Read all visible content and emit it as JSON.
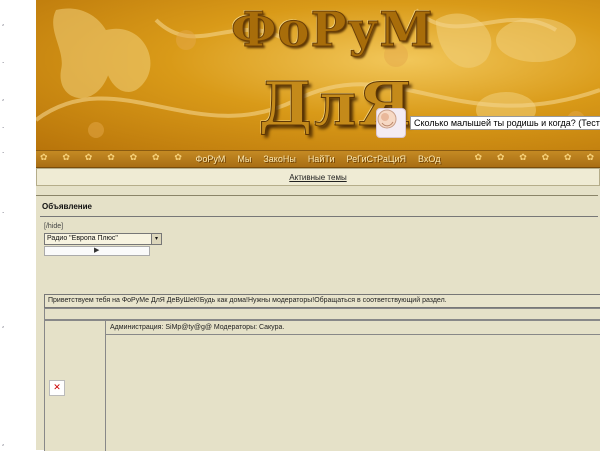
{
  "banner": {
    "title_line1": "ФоРуМ",
    "title_line2": "ДлЯ ДевуШеК",
    "quiz_link": "Сколько малышей ты родишь и когда? (Тест)"
  },
  "nav": {
    "items": [
      "ФоРуМ",
      "Мы",
      "ЗакоНы",
      "НайТи",
      "РеГиСтРаЦиЯ",
      "ВхОд"
    ]
  },
  "active_topics": "Активные темы",
  "announcement": {
    "title": "Объявление",
    "hide_tag": "[/hide]",
    "radio_select": "Радио \"Европа Плюс\"",
    "player_icon": "play-icon"
  },
  "welcome_text": "Приветствуем тебя на ФоРуМе ДлЯ ДеВуШеК!Будь как дома!Нужны модераторы!Обращаться в соответствующий раздел.",
  "admin_text": "Администрация: SiMp@ty@g@ Модераторы: Сакура.",
  "colors": {
    "banner_gold": "#d99a18",
    "nav_bar": "#b57818",
    "forum_bg": "#e5e1c8"
  }
}
